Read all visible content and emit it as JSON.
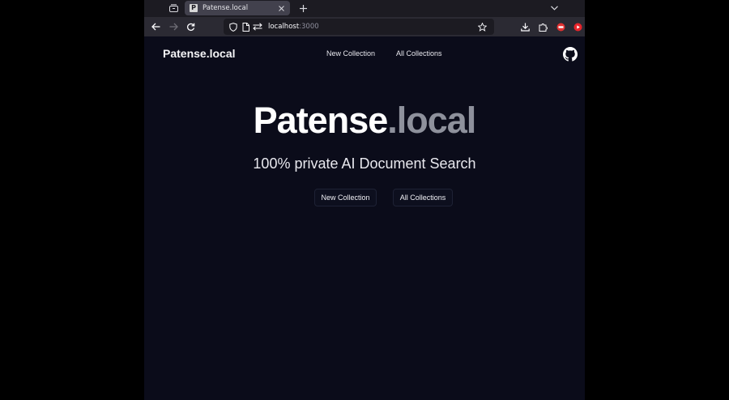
{
  "browser": {
    "tab": {
      "favicon_letter": "P",
      "title": "Patense.local"
    },
    "url": {
      "host": "localhost",
      "port": ":3000"
    }
  },
  "header": {
    "brand": "Patense.local",
    "nav": [
      {
        "label": "New Collection"
      },
      {
        "label": "All Collections"
      }
    ]
  },
  "hero": {
    "title_main": "Patense",
    "title_suffix": ".local",
    "subtitle": "100% private AI Document Search",
    "buttons": [
      {
        "label": "New Collection"
      },
      {
        "label": "All Collections"
      }
    ]
  },
  "colors": {
    "page_background": "#0b0c1a",
    "title_suffix": "#8e919c",
    "chrome_dark": "#1c1b22",
    "chrome_toolbar": "#2b2a33"
  }
}
